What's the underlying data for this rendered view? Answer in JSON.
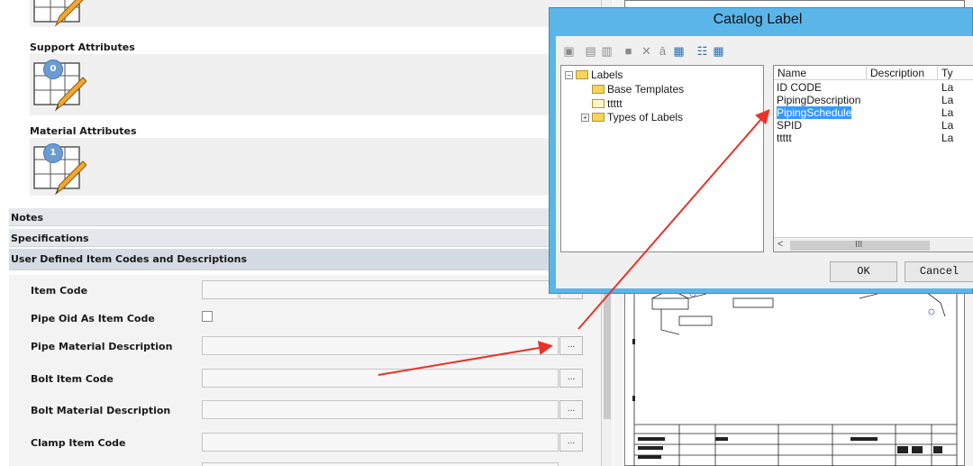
{
  "attributes": {
    "support_title": "Support Attributes",
    "support_count": "0",
    "material_title": "Material Attributes",
    "material_count": "1"
  },
  "sections": {
    "notes": "Notes",
    "specifications": "Specifications",
    "user_defined": "User Defined Item Codes and Descriptions"
  },
  "properties": [
    {
      "label": "Item Code",
      "value": "",
      "button": "..."
    },
    {
      "label": "Pipe Oid As Item Code",
      "checked": false
    },
    {
      "label": "Pipe Material Description",
      "value": "",
      "button": "..."
    },
    {
      "label": "Bolt Item Code",
      "value": "",
      "button": "..."
    },
    {
      "label": "Bolt Material Description",
      "value": "",
      "button": "..."
    },
    {
      "label": "Clamp Item Code",
      "value": "",
      "button": "..."
    }
  ],
  "dialog": {
    "title": "Catalog Label",
    "tree": {
      "root": "Labels",
      "children": [
        "Base Templates",
        "ttttt",
        "Types of Labels"
      ]
    },
    "list": {
      "columns": [
        "Name",
        "Description",
        "Ty"
      ],
      "items": [
        {
          "name": "ID CODE",
          "type": "La"
        },
        {
          "name": "PipingDescription",
          "type": "La"
        },
        {
          "name": "PipingSchedule",
          "type": "La",
          "selected": true
        },
        {
          "name": "SPID",
          "type": "La"
        },
        {
          "name": "ttttt",
          "type": "La"
        }
      ],
      "scroll_grip": "III"
    },
    "ok": "OK",
    "cancel": "Cancel"
  },
  "icons": {
    "toolbar": [
      "new-folder-icon",
      "copy-icon",
      "paste-icon",
      "save-icon",
      "delete-icon",
      "rename-icon",
      "properties-icon",
      "list-view-icon",
      "detail-view-icon"
    ]
  },
  "colors": {
    "dialog_frame": "#5ab6e8",
    "selection": "#3399ff",
    "annotation_arrow": "#e8332a"
  }
}
